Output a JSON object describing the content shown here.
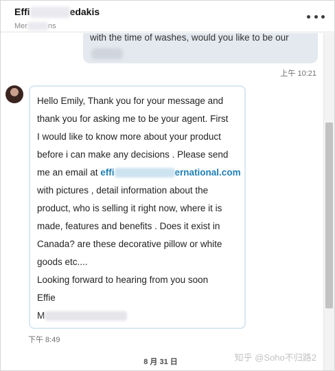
{
  "header": {
    "contact_name_start": "Effi",
    "contact_name_end": "edakis",
    "contact_subtitle_start": "Mer",
    "contact_subtitle_end": "ns",
    "more_icon": "more-horizontal-icon"
  },
  "messages": {
    "sent": {
      "text": "with the time of washes, would you like to be our",
      "time": "上午 10:21"
    },
    "received": {
      "lines": [
        "Hello Emily, Thank you for your message and",
        "thank you for asking me to be your agent. First",
        "I would like to know more about your product",
        "before i can make any decisions . Please send"
      ],
      "email_prefix": "me an email at ",
      "email_start": "effi",
      "email_end": "ernational.com",
      "lines_after": [
        "with pictures , detail information about the",
        "product, who is selling it right now, where it is",
        "made, features and benefits . Does it exist in",
        "Canada? are these decorative pillow or white",
        "goods etc....",
        "Looking forward to hearing from you soon",
        "Effie"
      ],
      "signature_start": "M",
      "time": "下午 8:49"
    }
  },
  "date_divider": "8 月 31 日",
  "watermark": "知乎 @Soho不归路2",
  "colors": {
    "link": "#1f7fb4",
    "sent_bubble": "#e4e9ef",
    "received_border": "#d8e8f2"
  }
}
